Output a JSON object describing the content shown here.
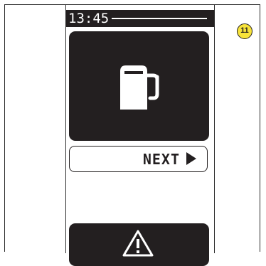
{
  "status_bar": {
    "time": "13:45"
  },
  "fuel_panel": {
    "icon": "fuel-pump-icon"
  },
  "next_button": {
    "label": "NEXT",
    "arrow_icon": "arrow-right-icon"
  },
  "warning_panel": {
    "icon": "warning-triangle-icon"
  },
  "step_badge": {
    "number": "11"
  },
  "colors": {
    "display_dark": "#231f20",
    "display_light": "#ffffff",
    "badge_fill": "#f7e33a"
  }
}
